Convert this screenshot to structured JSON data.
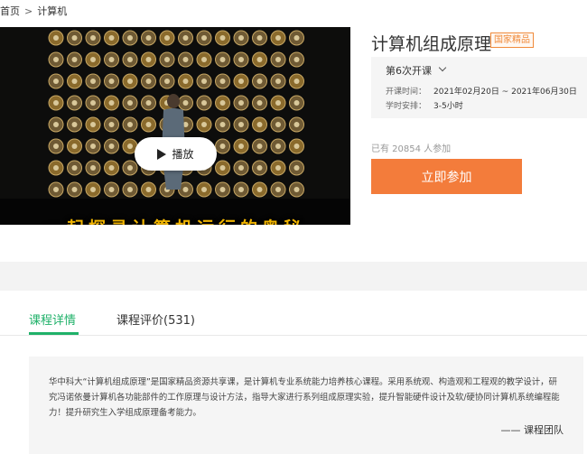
{
  "breadcrumb": {
    "home": "首页",
    "separator": ">",
    "current": "计算机"
  },
  "video": {
    "play_label": "播放",
    "slogan": "一起探寻计算机运行的奥秘"
  },
  "course": {
    "title": "计算机组成原理",
    "badge": "国家精品",
    "term": "第6次开课",
    "schedule": {
      "start_label": "开课时间：",
      "start_value": "2021年02月20日 ~ 2021年06月30日",
      "load_label": "学时安排：",
      "load_value": "3-5小时"
    },
    "enrolled": "已有 20854 人参加",
    "join_label": "立即参加"
  },
  "tabs": {
    "details": "课程详情",
    "reviews": "课程评价(531)"
  },
  "description": {
    "text": "华中科大“计算机组成原理”是国家精品资源共享课，是计算机专业系统能力培养核心课程。采用系统观、构造观和工程观的教学设计，研究冯诺依曼计算机各功能部件的工作原理与设计方法，指导大家进行系列组成原理实验，提升智能硬件设计及软/硬协同计算机系统编程能力！提升研究生入学组成原理备考能力。",
    "signature": "—— 课程团队"
  },
  "colors": {
    "accent_green": "#1fb169",
    "join_orange": "#f37c3b",
    "badge_orange": "#f08a3a",
    "slogan_gold": "#f0b400"
  }
}
